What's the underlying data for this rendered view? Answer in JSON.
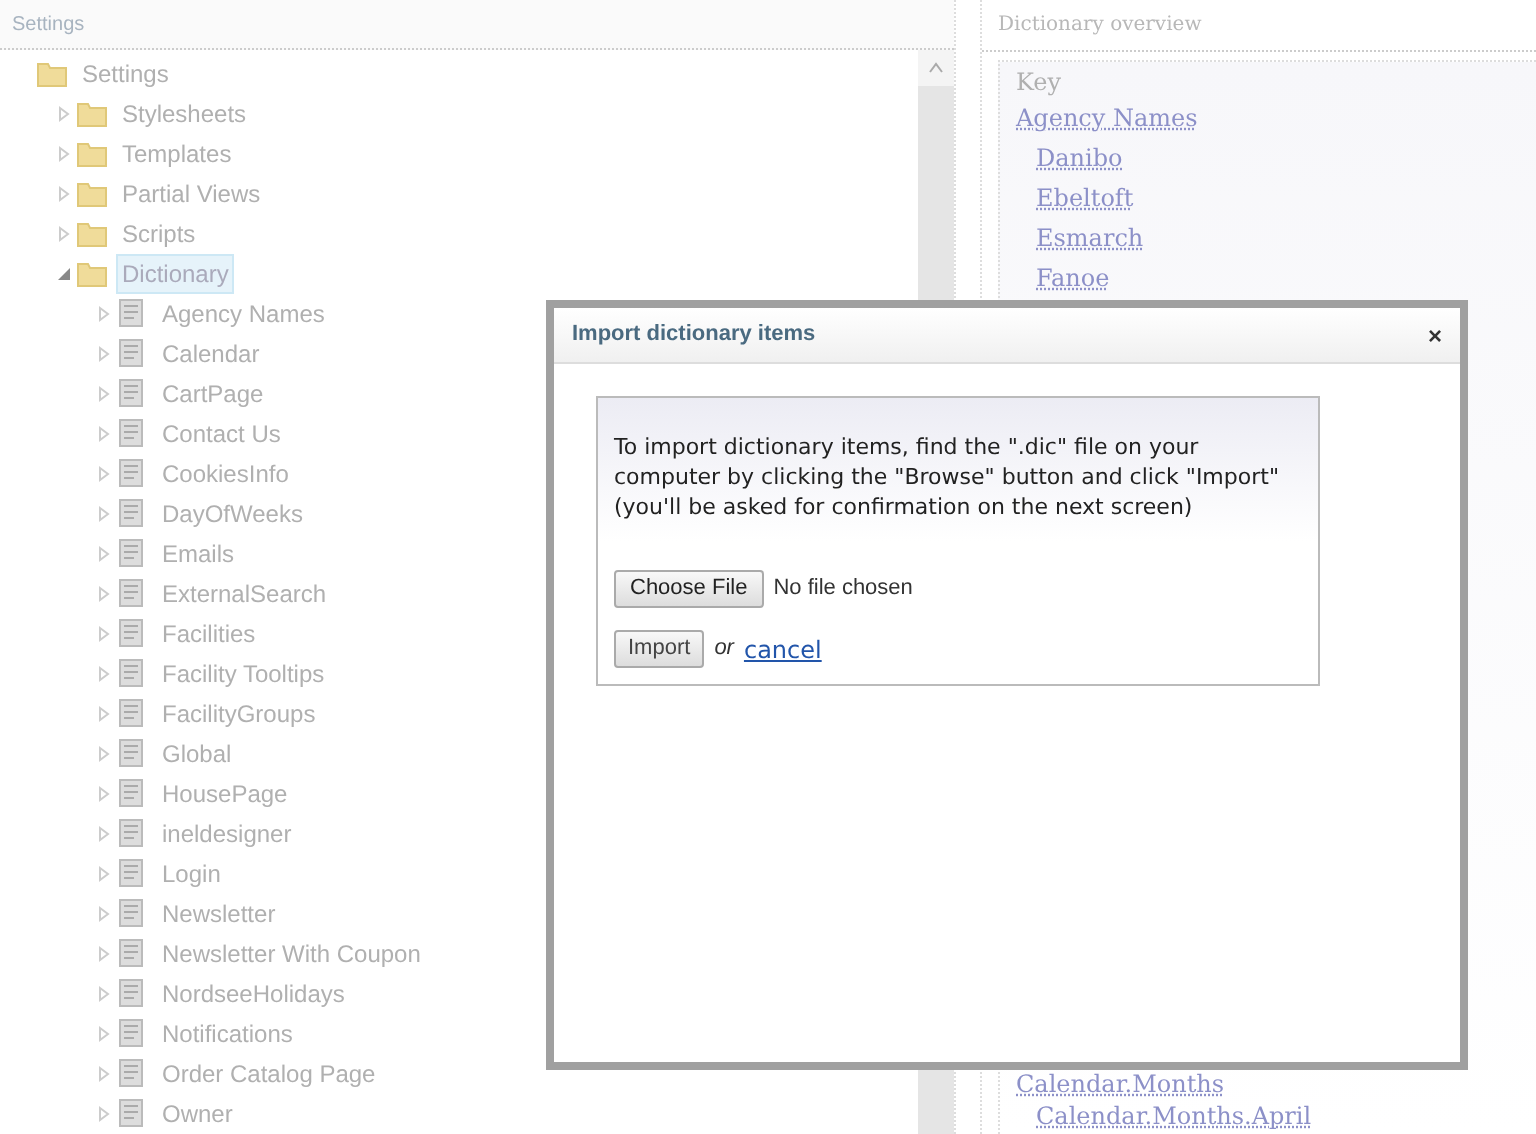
{
  "settings_panel": {
    "title": "Settings",
    "tree": [
      {
        "label": "Settings",
        "kind": "folder",
        "selected": false,
        "children": [
          {
            "label": "Stylesheets",
            "kind": "folder",
            "expanded": false,
            "selected": false
          },
          {
            "label": "Templates",
            "kind": "folder",
            "expanded": false,
            "selected": false
          },
          {
            "label": "Partial Views",
            "kind": "folder",
            "expanded": false,
            "selected": false
          },
          {
            "label": "Scripts",
            "kind": "folder",
            "expanded": false,
            "selected": false
          },
          {
            "label": "Dictionary",
            "kind": "folder",
            "expanded": true,
            "selected": true,
            "children": [
              {
                "label": "Agency Names",
                "kind": "item",
                "expanded": false,
                "selected": false
              },
              {
                "label": "Calendar",
                "kind": "item",
                "expanded": false,
                "selected": false
              },
              {
                "label": "CartPage",
                "kind": "item",
                "expanded": false,
                "selected": false
              },
              {
                "label": "Contact Us",
                "kind": "item",
                "expanded": false,
                "selected": false
              },
              {
                "label": "CookiesInfo",
                "kind": "item",
                "expanded": false,
                "selected": false
              },
              {
                "label": "DayOfWeeks",
                "kind": "item",
                "expanded": false,
                "selected": false
              },
              {
                "label": "Emails",
                "kind": "item",
                "expanded": false,
                "selected": false
              },
              {
                "label": "ExternalSearch",
                "kind": "item",
                "expanded": false,
                "selected": false
              },
              {
                "label": "Facilities",
                "kind": "item",
                "expanded": false,
                "selected": false
              },
              {
                "label": "Facility Tooltips",
                "kind": "item",
                "expanded": false,
                "selected": false
              },
              {
                "label": "FacilityGroups",
                "kind": "item",
                "expanded": false,
                "selected": false
              },
              {
                "label": "Global",
                "kind": "item",
                "expanded": false,
                "selected": false
              },
              {
                "label": "HousePage",
                "kind": "item",
                "expanded": false,
                "selected": false
              },
              {
                "label": "ineldesigner",
                "kind": "item",
                "expanded": false,
                "selected": false
              },
              {
                "label": "Login",
                "kind": "item",
                "expanded": false,
                "selected": false
              },
              {
                "label": "Newsletter",
                "kind": "item",
                "expanded": false,
                "selected": false
              },
              {
                "label": "Newsletter With Coupon",
                "kind": "item",
                "expanded": false,
                "selected": false
              },
              {
                "label": "NordseeHolidays",
                "kind": "item",
                "expanded": false,
                "selected": false
              },
              {
                "label": "Notifications",
                "kind": "item",
                "expanded": false,
                "selected": false
              },
              {
                "label": "Order Catalog Page",
                "kind": "item",
                "expanded": false,
                "selected": false
              },
              {
                "label": "Owner",
                "kind": "item",
                "expanded": false,
                "selected": false
              }
            ]
          }
        ]
      }
    ]
  },
  "overview_panel": {
    "title": "Dictionary overview",
    "heading": "Key",
    "top_entries": [
      {
        "label": "Agency Names",
        "kind": "parent"
      },
      {
        "label": "Danibo",
        "kind": "child"
      },
      {
        "label": "Ebeltoft",
        "kind": "child"
      },
      {
        "label": "Esmarch",
        "kind": "child"
      },
      {
        "label": "Fanoe",
        "kind": "child"
      }
    ],
    "bottom_entries": [
      {
        "label": "Calendar.Months",
        "kind": "parent"
      },
      {
        "label": "Calendar.Months.April",
        "kind": "child"
      }
    ]
  },
  "dialog": {
    "title": "Import dictionary items",
    "close": "×",
    "message": "To import dictionary items, find the \".dic\" file on your computer by clicking the \"Browse\" button and click \"Import\" (you'll be asked for confirmation on the next screen)",
    "file_button": "Choose File",
    "file_status": "No file chosen",
    "import_button": "Import",
    "or": "or",
    "cancel": "cancel"
  }
}
